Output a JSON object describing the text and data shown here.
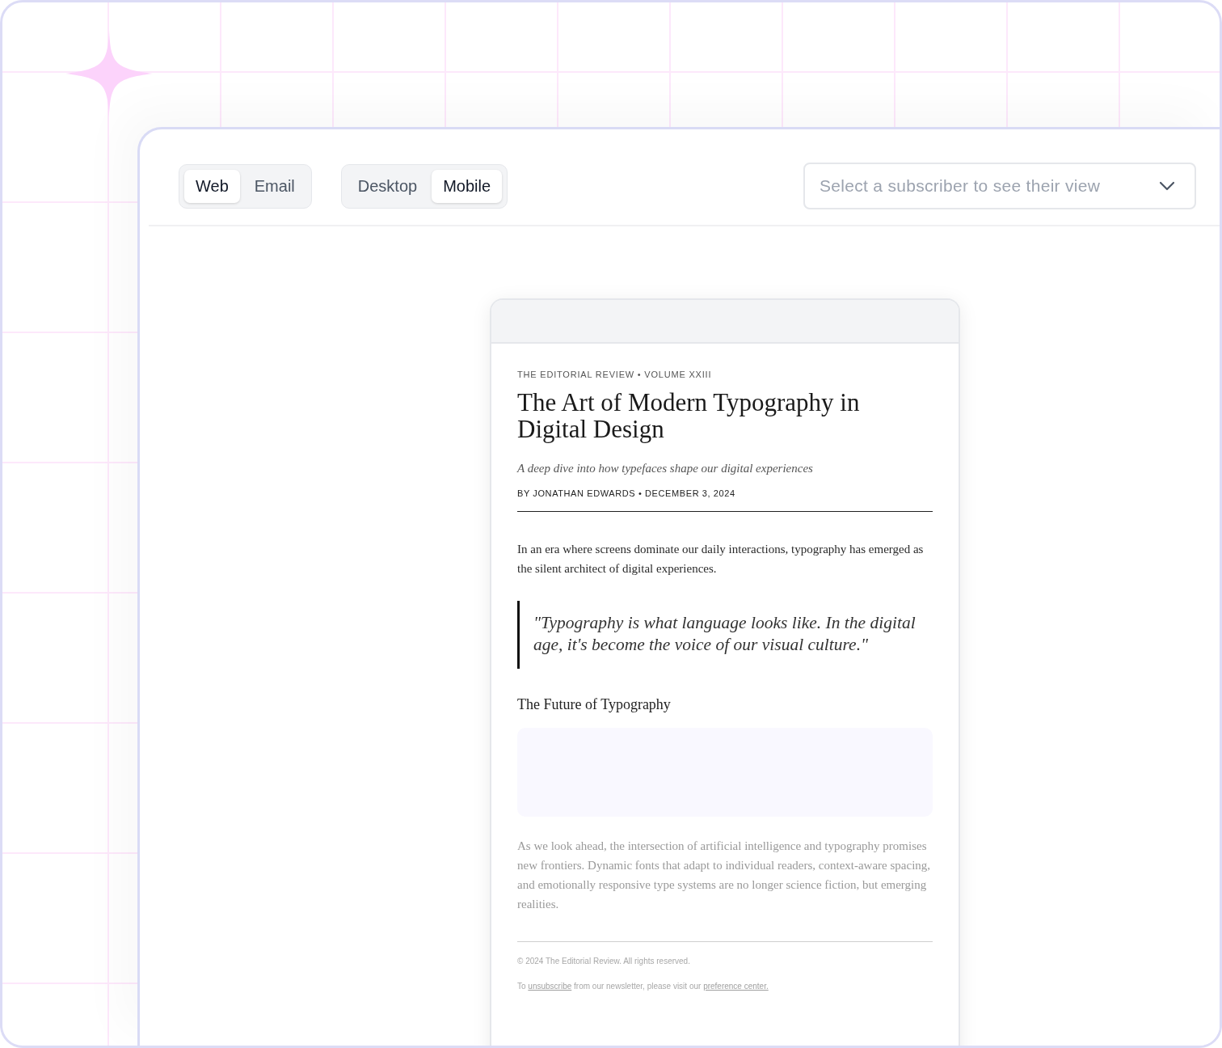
{
  "segments": [
    {
      "options": [
        {
          "label": "Web",
          "selected": true
        },
        {
          "label": "Email",
          "selected": false
        }
      ]
    },
    {
      "options": [
        {
          "label": "Desktop",
          "selected": false
        },
        {
          "label": "Mobile",
          "selected": true
        }
      ]
    }
  ],
  "subscriber_select": {
    "placeholder": "Select a subscriber to see their view"
  },
  "preview": {
    "kicker": "THE EDITORIAL REVIEW • VOLUME XXIII",
    "title": "The Art of Modern Typography in Digital Design",
    "subtitle": "A deep dive into how typefaces shape our digital experiences",
    "byline": "BY JONATHAN EDWARDS • DECEMBER 3, 2024",
    "intro": "In an era where screens dominate our daily interactions, typography has emerged as the silent architect of digital experiences.",
    "quote": "\"Typography is what language looks like. In the digital age, it's become the voice of our visual culture.\"",
    "section_heading": "The Future of Typography",
    "body": "As we look ahead, the intersection of artificial intelligence and typography promises new frontiers. Dynamic fonts that adapt to individual readers, context-aware spacing, and emotionally responsive type systems are no longer science fiction, but emerging realities.",
    "footer": {
      "copyright": "© 2024 The Editorial Review. All rights reserved.",
      "notice": [
        {
          "kind": "text",
          "text": "To "
        },
        {
          "kind": "link",
          "text": "unsubscribe"
        },
        {
          "kind": "text",
          "text": " from our newsletter, please visit our "
        },
        {
          "kind": "link",
          "text": "preference center."
        }
      ]
    }
  }
}
